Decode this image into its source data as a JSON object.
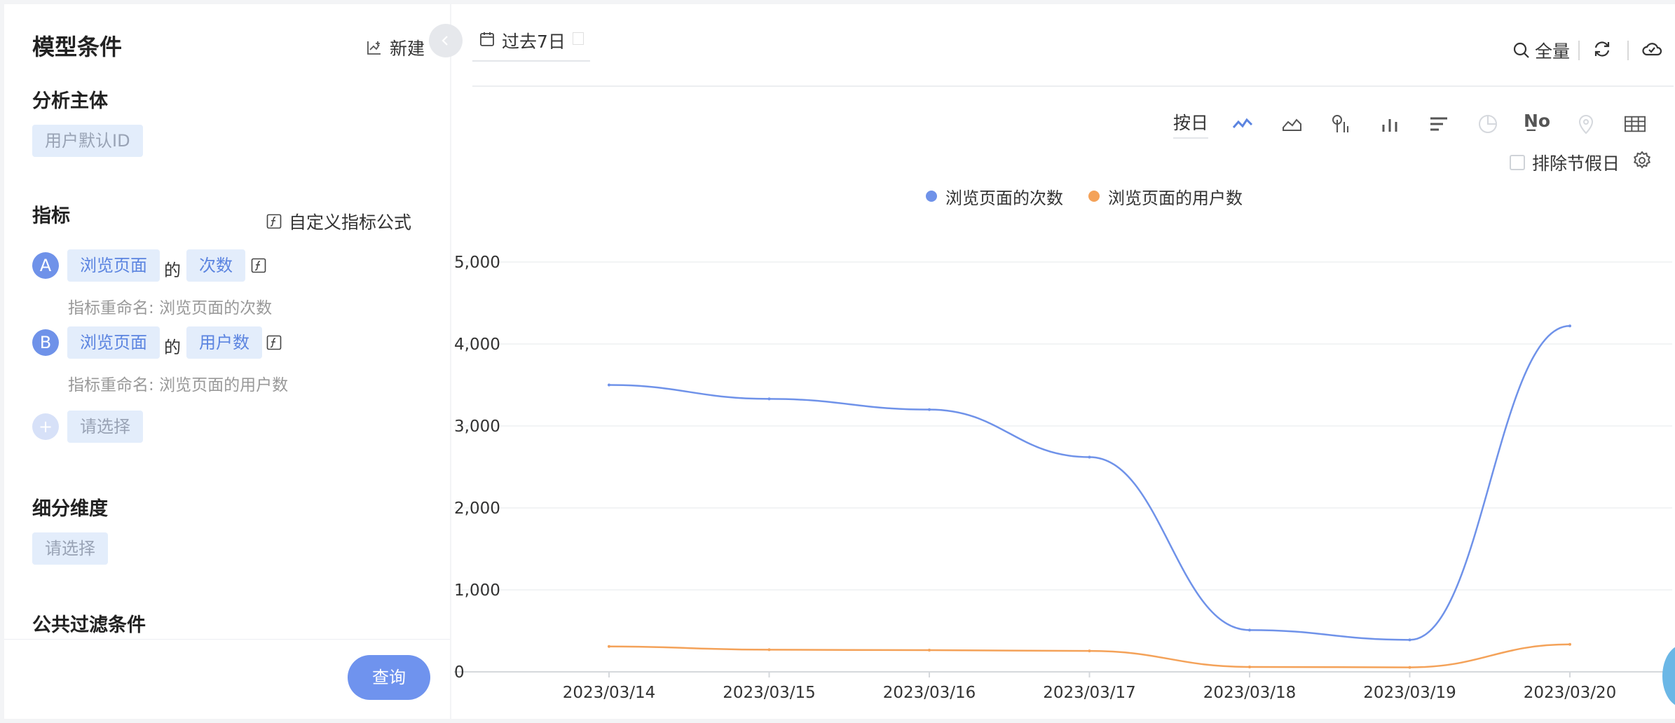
{
  "left": {
    "title": "模型条件",
    "new_label": "新建",
    "subject": {
      "title": "分析主体",
      "value": "用户默认ID"
    },
    "metrics": {
      "title": "指标",
      "custom_formula_label": "自定义指标公式",
      "items": [
        {
          "badge": "A",
          "event": "浏览页面",
          "of": "的",
          "measure": "次数",
          "rename_label": "指标重命名:",
          "rename_value": "浏览页面的次数"
        },
        {
          "badge": "B",
          "event": "浏览页面",
          "of": "的",
          "measure": "用户数",
          "rename_label": "指标重命名:",
          "rename_value": "浏览页面的用户数"
        }
      ],
      "add_placeholder": "请选择"
    },
    "breakdown": {
      "title": "细分维度",
      "placeholder": "请选择"
    },
    "filter": {
      "title": "公共过滤条件"
    },
    "query_label": "查询"
  },
  "right": {
    "date_range": "过去7日",
    "tools": {
      "full_label": "全量"
    },
    "granularity": "按日",
    "chart_type_icons": [
      "line-chart-icon",
      "area-chart-icon",
      "funnel-icon",
      "bar-chart-icon",
      "horizontal-bar-icon",
      "pie-chart-icon",
      "number-icon",
      "map-pin-icon",
      "table-icon"
    ],
    "number_glyph": "N̲o",
    "exclude_holidays_label": "排除节假日",
    "colors": {
      "primary": "#6f92e9",
      "series1": "#6f92e9",
      "series2": "#f4a259"
    }
  },
  "chart_data": {
    "type": "line",
    "x": [
      "2023/03/14",
      "2023/03/15",
      "2023/03/16",
      "2023/03/17",
      "2023/03/18",
      "2023/03/19",
      "2023/03/20"
    ],
    "series": [
      {
        "name": "浏览页面的次数",
        "values": [
          3500,
          3330,
          3200,
          2620,
          510,
          390,
          4220
        ]
      },
      {
        "name": "浏览页面的用户数",
        "values": [
          310,
          270,
          265,
          255,
          60,
          55,
          335
        ]
      }
    ],
    "y_ticks": [
      "0",
      "1,000",
      "2,000",
      "3,000",
      "4,000",
      "5,000"
    ],
    "ylim": [
      0,
      5000
    ],
    "grid": true,
    "legend_position": "top-center",
    "smooth": true
  }
}
